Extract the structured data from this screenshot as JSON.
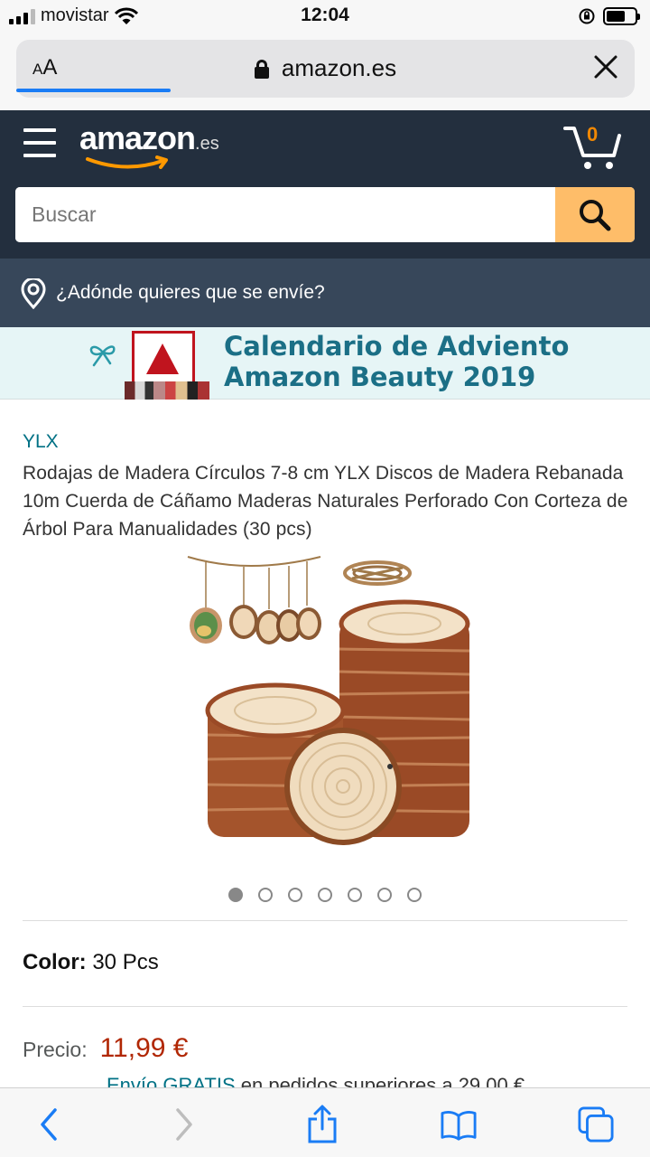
{
  "status_bar": {
    "carrier": "movistar",
    "time": "12:04"
  },
  "browser": {
    "text_size_label_small": "A",
    "text_size_label_large": "A",
    "url": "amazon.es",
    "load_progress": 0.25
  },
  "header": {
    "logo_word": "amazon",
    "logo_tld": ".es",
    "cart_count": "0",
    "search_placeholder": "Buscar"
  },
  "delivery": {
    "prompt": "¿Adónde quieres que se envíe?"
  },
  "banner": {
    "line1": "Calendario de Adviento",
    "line2": "Amazon Beauty 2019"
  },
  "product": {
    "brand": "YLX",
    "title": "Rodajas de Madera Círculos 7-8 cm YLX Discos de Madera Rebanada 10m Cuerda de Cáñamo Maderas Naturales Perforado Con Corteza de Árbol Para Manualidades (30 pcs)",
    "image_count": 7,
    "active_image": 1,
    "color_label": "Color:",
    "color_value": "30 Pcs",
    "price_label": "Precio:",
    "price_value": "11,99 €",
    "shipping_link": "Envío GRATIS",
    "shipping_text": " en pedidos superiores a 29,00 €"
  },
  "colors": {
    "amazon_dark": "#232f3e",
    "amazon_nav": "#37475a",
    "search_button": "#febd69",
    "link": "#007185",
    "price": "#b12704",
    "safari_blue": "#1a7cf5"
  },
  "toolbar": {
    "icons": [
      "back-icon",
      "forward-icon",
      "share-icon",
      "bookmarks-icon",
      "tabs-icon"
    ]
  }
}
